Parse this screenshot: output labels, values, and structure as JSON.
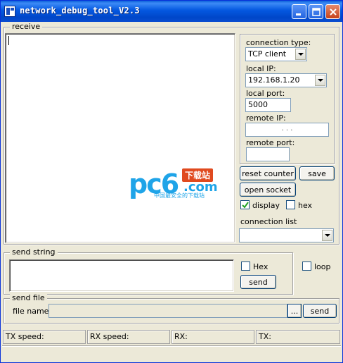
{
  "window": {
    "title": "network_debug_tool_V2.3"
  },
  "receive": {
    "group_label": "receive",
    "content": ""
  },
  "settings": {
    "connection_type_label": "connection type:",
    "connection_type_value": "TCP client",
    "local_ip_label": "local IP:",
    "local_ip_value": "192.168.1.20",
    "local_port_label": "local port:",
    "local_port_value": "5000",
    "remote_ip_label": "remote IP:",
    "remote_ip_value": ".     .     .",
    "remote_port_label": "remote port:",
    "remote_port_value": ""
  },
  "controls": {
    "reset_counter_label": "reset counter",
    "save_label": "save",
    "open_socket_label": "open socket",
    "display_label": "display",
    "display_checked": true,
    "hex_label": "hex",
    "hex_checked": false,
    "connection_list_label": "connection list",
    "connection_list_value": ""
  },
  "send_string": {
    "group_label": "send string",
    "content": "",
    "hex_label": "Hex",
    "hex_checked": false,
    "send_label": "send",
    "loop_label": "loop",
    "loop_checked": false
  },
  "send_file": {
    "group_label": "send file",
    "file_name_label": "file name",
    "file_name_value": "",
    "browse_label": "...",
    "send_label": "send"
  },
  "status": {
    "tx_speed": "TX speed:",
    "rx_speed": "RX speed:",
    "rx": "RX:",
    "tx": "TX:"
  },
  "watermark": {
    "brand": "pc6",
    "top_text": "下载站",
    "domain": ".com",
    "sub_text": "中国最安全的下载站"
  },
  "colors": {
    "title_bar": "#0054e3",
    "face": "#ece9d8",
    "watermark": "#1fa4e8",
    "watermark_badge": "#e04a1f"
  }
}
